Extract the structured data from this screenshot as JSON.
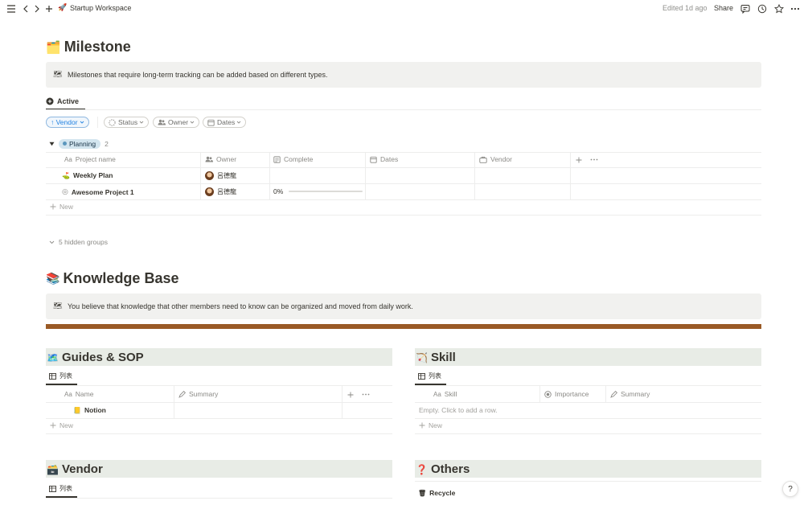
{
  "topbar": {
    "workspace_emoji": "🚀",
    "workspace_name": "Startup Workspace",
    "edited": "Edited 1d ago",
    "share": "Share"
  },
  "milestone": {
    "emoji": "🗂️",
    "title": "Milestone",
    "callout_icon": "🗺",
    "callout_text": "Milestones that require long-term tracking can be added based on different types.",
    "tab": "Active",
    "filters": {
      "vendor": "↑ Vendor",
      "status": "Status",
      "owner": "Owner",
      "dates": "Dates"
    },
    "group": {
      "name": "Planning",
      "count": "2"
    },
    "columns": {
      "name": "Project name",
      "owner": "Owner",
      "complete": "Complete",
      "dates": "Dates",
      "vendor": "Vendor"
    },
    "rows": [
      {
        "icon": "⛳",
        "name": "Weekly Plan",
        "owner": "呂德龍",
        "complete": ""
      },
      {
        "icon": "◎",
        "name": "Awesome Project 1",
        "owner": "呂德龍",
        "complete": "0%",
        "progress": 0
      }
    ],
    "new_label": "New",
    "hidden_groups": "5 hidden groups"
  },
  "knowledge": {
    "emoji": "📚",
    "title": "Knowledge Base",
    "callout_icon": "🗺",
    "callout_text": "You believe that knowledge that other members need to know can be organized and moved from daily work.",
    "divider_color": "#9a5a26"
  },
  "guides": {
    "emoji": "🗺️",
    "title": "Guides & SOP",
    "tab": "列表",
    "columns": {
      "name": "Name",
      "summary": "Summary"
    },
    "rows": [
      {
        "icon": "📒",
        "name": "Notion"
      }
    ],
    "new_label": "New"
  },
  "skill": {
    "emoji": "🏹",
    "title": "Skill",
    "tab": "列表",
    "columns": {
      "name": "Skill",
      "importance": "Importance",
      "summary": "Summary"
    },
    "empty": "Empty. Click to add a row.",
    "new_label": "New"
  },
  "vendor": {
    "emoji": "🗃️",
    "title": "Vendor",
    "tab": "列表"
  },
  "others": {
    "emoji": "❓",
    "title": "Others",
    "items": [
      {
        "icon": "🗑",
        "label": "Recycle"
      }
    ]
  },
  "help": "?"
}
